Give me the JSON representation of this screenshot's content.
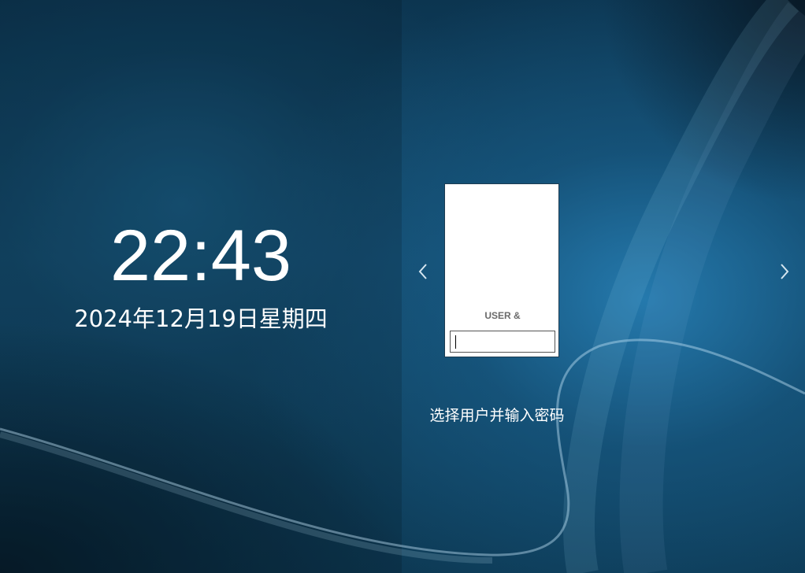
{
  "clock": {
    "time": "22:43",
    "date": "2024年12月19日星期四"
  },
  "user_card": {
    "label": "USER &",
    "password_value": ""
  },
  "hint": "选择用户并输入密码",
  "nav": {
    "prev_icon": "chevron-left-icon",
    "next_icon": "chevron-right-icon"
  },
  "colors": {
    "background": "#134a6b",
    "text": "#ffffff",
    "card": "#ffffff",
    "card_border": "#1d3c52"
  }
}
